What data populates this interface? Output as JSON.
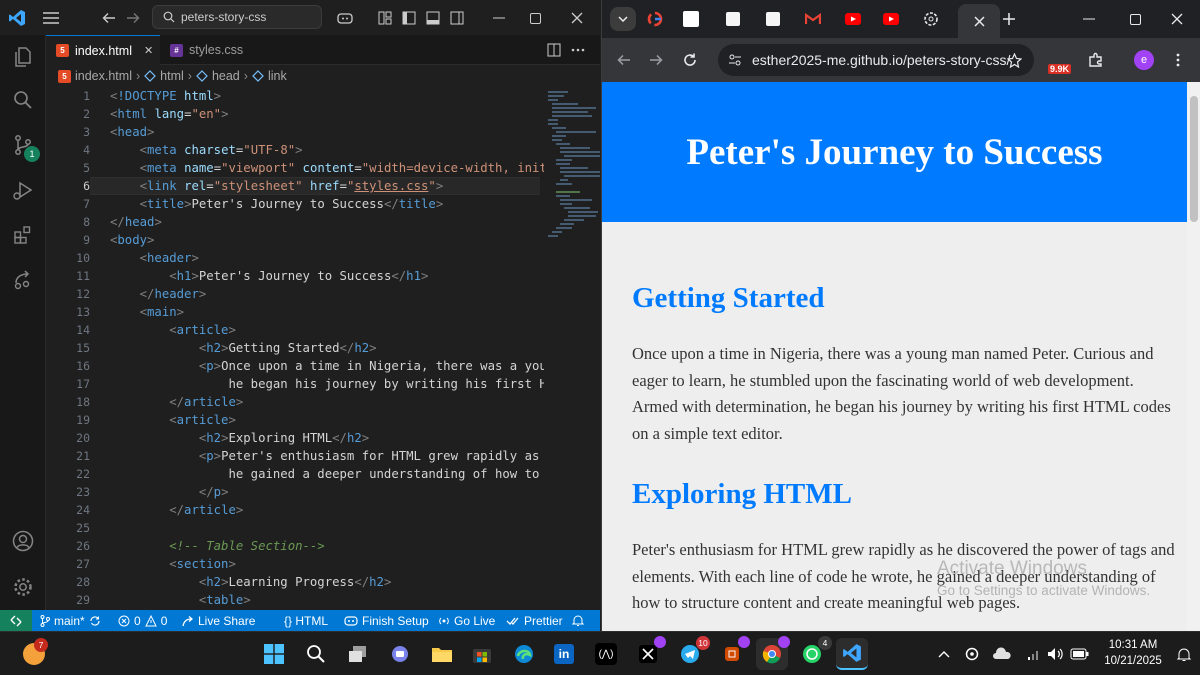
{
  "vscode": {
    "search_text": "peters-story-css",
    "tabs": [
      {
        "label": "index.html",
        "close": "✕"
      },
      {
        "label": "styles.css"
      }
    ],
    "breadcrumbs": [
      "index.html",
      "html",
      "head",
      "link"
    ],
    "scm_badge": "1",
    "line_numbers": [
      "1",
      "2",
      "3",
      "4",
      "5",
      "6",
      "7",
      "8",
      "9",
      "10",
      "11",
      "12",
      "13",
      "14",
      "15",
      "16",
      "17",
      "18",
      "19",
      "20",
      "21",
      "22",
      "23",
      "24",
      "25",
      "26",
      "27",
      "28",
      "29"
    ],
    "status": {
      "branch": "main*",
      "errors": "0",
      "warnings": "0",
      "live_share": "Live Share",
      "language": "{} HTML",
      "finish_setup": "Finish Setup",
      "go_live": "Go Live",
      "prettier": "Prettier"
    }
  },
  "chrome": {
    "url": "esther2025-me.github.io/peters-story-css/",
    "extension_badge": "9.9K",
    "profile_initial": "e",
    "page": {
      "title": "Peter's Journey to Success",
      "sections": [
        {
          "heading": "Getting Started",
          "text": "Once upon a time in Nigeria, there was a young man named Peter. Curious and eager to learn, he stumbled upon the fascinating world of web development. Armed with determination, he began his journey by writing his first HTML codes on a simple text editor."
        },
        {
          "heading": "Exploring HTML",
          "text": "Peter's enthusiasm for HTML grew rapidly as he discovered the power of tags and elements. With each line of code he wrote, he gained a deeper understanding of how to structure content and create meaningful web pages."
        }
      ]
    },
    "watermark": {
      "title": "Activate Windows",
      "subtitle": "Go to Settings to activate Windows."
    }
  },
  "taskbar": {
    "start_badge": "7",
    "telegram_badge": "10",
    "whatsapp_badge": "4",
    "time": "10:31 AM",
    "date": "10/21/2025"
  },
  "colors": {
    "accent": "#0078d4",
    "header_blue": "#007bff",
    "remote": "#16825d",
    "page_bg": "#eeeeee"
  }
}
